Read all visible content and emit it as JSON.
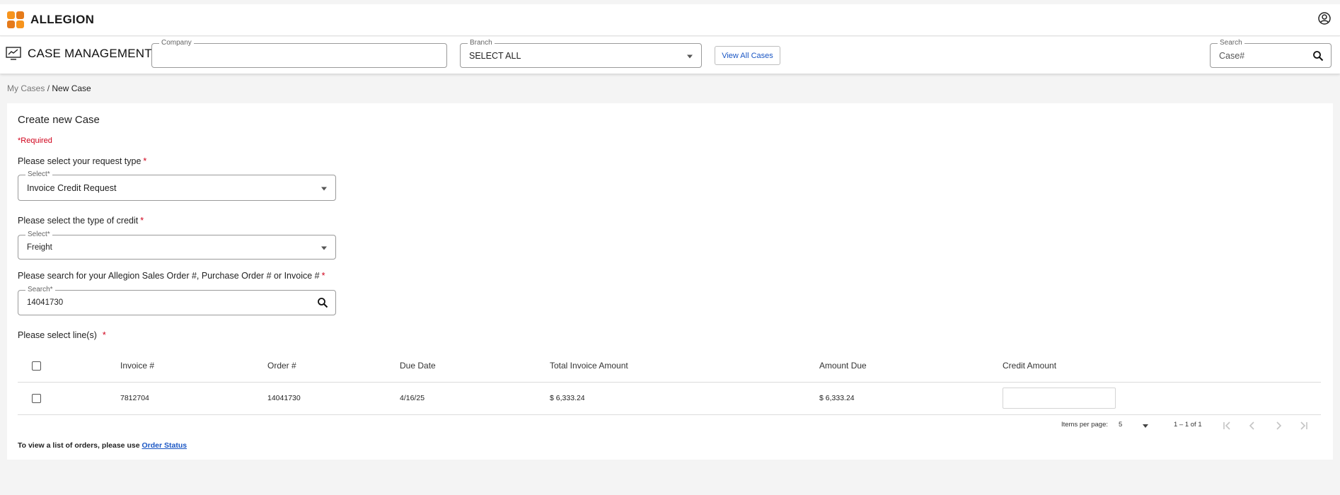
{
  "brand": {
    "name": "ALLEGION",
    "colors": {
      "orange": "#f7941d",
      "orange_dark": "#e57a1a"
    }
  },
  "header": {
    "title": "CASE MANAGEMENT",
    "company": {
      "label": "Company",
      "value": ""
    },
    "branch": {
      "label": "Branch",
      "value": "SELECT ALL"
    },
    "view_all_label": "View All Cases",
    "search": {
      "label": "Search",
      "placeholder": "Case#"
    },
    "icons": {
      "user": "account-circle-icon",
      "search": "search-icon",
      "dashboard": "monitor-chart-icon"
    }
  },
  "breadcrumb": {
    "parent": "My Cases",
    "separator": "/",
    "current": "New Case"
  },
  "form": {
    "title": "Create new Case",
    "required_note": "*Required",
    "request_type": {
      "question": "Please select your request type",
      "field_label": "Select*",
      "value": "Invoice Credit Request"
    },
    "credit_type": {
      "question": "Please select the type of credit",
      "field_label": "Select*",
      "value": "Freight"
    },
    "order_search": {
      "question": "Please search for your Allegion Sales Order #, Purchase Order # or Invoice #",
      "field_label": "Search*",
      "value": "14041730"
    },
    "lines_question": "Please select line(s)",
    "required_star": "*"
  },
  "table": {
    "columns": [
      "Invoice #",
      "Order #",
      "Due Date",
      "Total Invoice Amount",
      "Amount Due",
      "Credit Amount"
    ],
    "rows": [
      {
        "invoice": "7812704",
        "order": "14041730",
        "due_date": "4/16/25",
        "total": "$ 6,333.24",
        "amount_due": "$ 6,333.24",
        "credit": ""
      }
    ]
  },
  "paginator": {
    "items_per_page_label": "Items per page:",
    "items_per_page": "5",
    "range": "1 – 1 of 1"
  },
  "footer": {
    "text": "To view a list of orders, please use",
    "link": "Order Status"
  }
}
